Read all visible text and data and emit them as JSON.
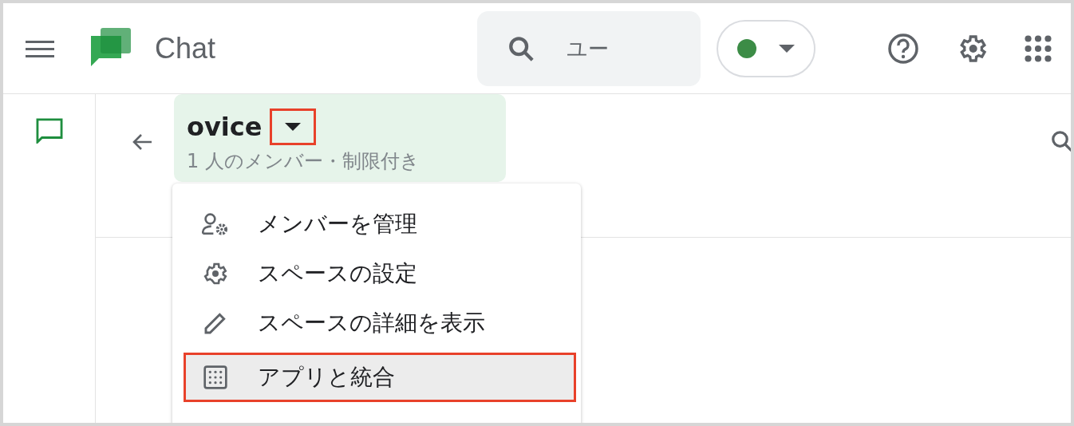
{
  "app": {
    "title": "Chat"
  },
  "search": {
    "placeholder": "ユー"
  },
  "space": {
    "name": "ovice",
    "subtitle": "1 人のメンバー・制限付き",
    "caret_highlighted": true
  },
  "menu": {
    "items": [
      {
        "kind": "members",
        "label": "メンバーを管理",
        "selected": false,
        "highlighted": false
      },
      {
        "kind": "settings",
        "label": "スペースの設定",
        "selected": false,
        "highlighted": false
      },
      {
        "kind": "edit",
        "label": "スペースの詳細を表示",
        "selected": false,
        "highlighted": false
      },
      {
        "kind": "apps",
        "label": "アプリと統合",
        "selected": true,
        "highlighted": true
      }
    ]
  }
}
